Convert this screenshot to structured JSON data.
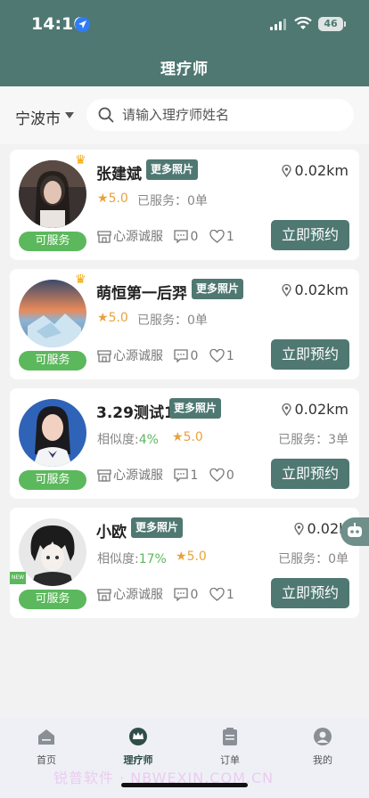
{
  "status_bar": {
    "time": "14:16",
    "battery": "46"
  },
  "header": {
    "title": "理疗师"
  },
  "search": {
    "city": "宁波市",
    "placeholder": "请输入理疗师姓名"
  },
  "therapists": [
    {
      "name": "张建斌",
      "photos_label": "更多照片",
      "distance": "0.02km",
      "rating": "5.0",
      "served": "已服务：0单",
      "shop": "心源诚服",
      "comments": "0",
      "likes": "1",
      "status": "可服务",
      "book_label": "立即预约",
      "crown": true
    },
    {
      "name": "萌恒第一后羿",
      "photos_label": "更多照片",
      "distance": "0.02km",
      "rating": "5.0",
      "served": "已服务：0单",
      "shop": "心源诚服",
      "comments": "0",
      "likes": "1",
      "status": "可服务",
      "book_label": "立即预约",
      "crown": true
    },
    {
      "name": "3.29测试1",
      "photos_label": "更多照片",
      "distance": "0.02km",
      "similarity_label": "相似度:",
      "similarity": "4%",
      "rating": "5.0",
      "served": "已服务：3单",
      "shop": "心源诚服",
      "comments": "1",
      "likes": "0",
      "status": "可服务",
      "book_label": "立即预约"
    },
    {
      "name": "小欧",
      "photos_label": "更多照片",
      "distance": "0.02km",
      "similarity_label": "相似度:",
      "similarity": "17%",
      "rating": "5.0",
      "served": "已服务：0单",
      "shop": "心源诚服",
      "comments": "0",
      "likes": "1",
      "status": "可服务",
      "book_label": "立即预约",
      "new_badge": "NEW"
    }
  ],
  "tabbar": [
    {
      "label": "首页"
    },
    {
      "label": "理疗师"
    },
    {
      "label": "订单"
    },
    {
      "label": "我的"
    }
  ],
  "watermark": "锐普软件 · NBWEXIN.COM.CN",
  "colors": {
    "primary": "#4f7872",
    "available": "#5cb85c",
    "rating": "#e8a23c"
  }
}
